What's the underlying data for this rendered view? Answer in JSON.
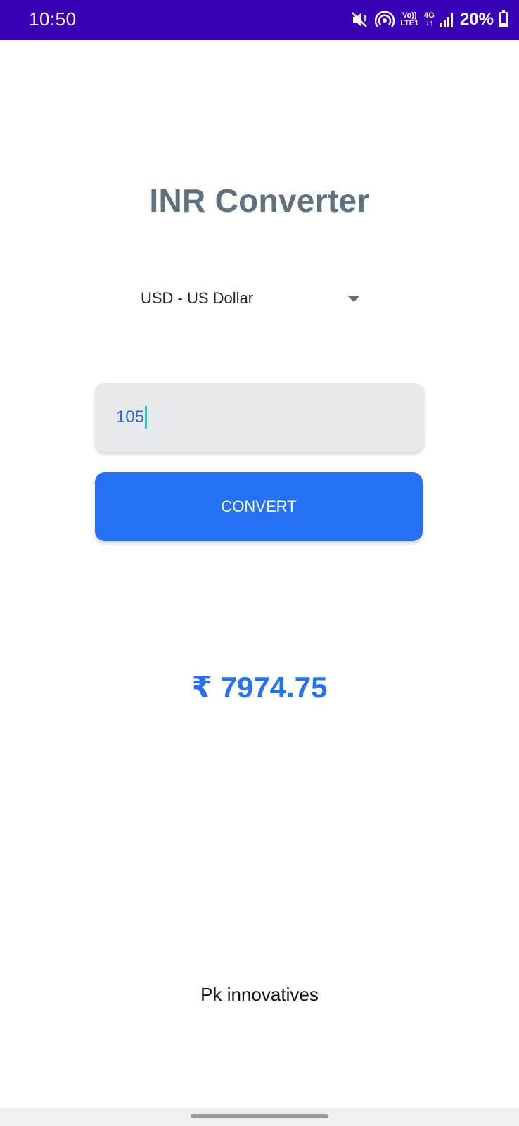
{
  "status_bar": {
    "time": "10:50",
    "volte_label": "Vo))\nLTE1",
    "network_label": "4G",
    "battery_percent_text": "20%",
    "battery_level": 0.2,
    "icons": [
      "mute-vibrate-icon",
      "hotspot-icon",
      "volte-icon",
      "4g-icon",
      "signal-bars-icon",
      "battery-icon"
    ],
    "background_color": "#3a00b5"
  },
  "app": {
    "title": "INR Converter",
    "currency_select": {
      "selected": "USD - US Dollar"
    },
    "amount_input": {
      "value": "105"
    },
    "convert_button_label": "CONVERT",
    "result": {
      "symbol": "₹",
      "value": "7974.75"
    },
    "footer": "Pk innovatives",
    "accent_color": "#2471f5",
    "title_color": "#5e7180"
  }
}
